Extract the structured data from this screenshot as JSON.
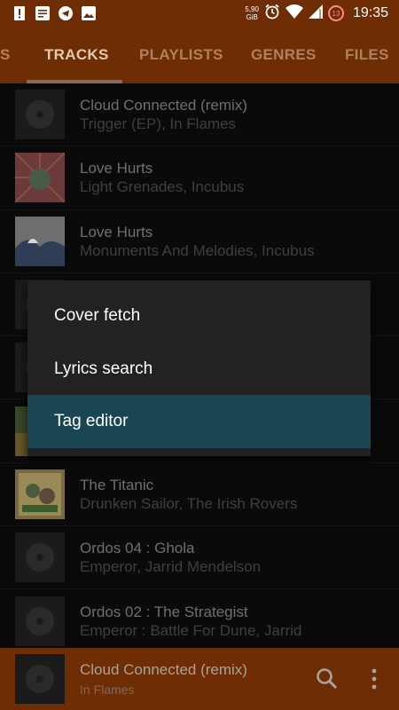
{
  "status_bar": {
    "net_speed_value": "5,90",
    "net_speed_unit": "GiB",
    "notification_badge": "13",
    "time": "19:35"
  },
  "tabs": [
    {
      "label": "S"
    },
    {
      "label": "TRACKS"
    },
    {
      "label": "PLAYLISTS"
    },
    {
      "label": "GENRES"
    },
    {
      "label": "FILES"
    }
  ],
  "tracks": [
    {
      "title": "Cloud Connected (remix)",
      "subtitle": "Trigger (EP), In Flames"
    },
    {
      "title": "Love Hurts",
      "subtitle": "Light Grenades, Incubus"
    },
    {
      "title": "Love Hurts",
      "subtitle": "Monuments And Melodies, Incubus"
    },
    {
      "title": "",
      "subtitle": ""
    },
    {
      "title": "",
      "subtitle": ""
    },
    {
      "title": "",
      "subtitle": ""
    },
    {
      "title": "The Titanic",
      "subtitle": "Drunken Sailor, The Irish Rovers"
    },
    {
      "title": "Ordos 04 : Ghola",
      "subtitle": "Emperor, Jarrid Mendelson"
    },
    {
      "title": "Ordos 02 : The Strategist",
      "subtitle": "Emperor : Battle For Dune, Jarrid"
    }
  ],
  "context_menu": {
    "items": [
      {
        "label": "Cover fetch"
      },
      {
        "label": "Lyrics search"
      },
      {
        "label": "Tag editor"
      }
    ]
  },
  "now_playing": {
    "title": "Cloud Connected (remix)",
    "artist": "In Flames"
  },
  "colors": {
    "accent": "#6e2d03",
    "menu_bg": "#222222",
    "menu_highlight": "#1a4654"
  }
}
